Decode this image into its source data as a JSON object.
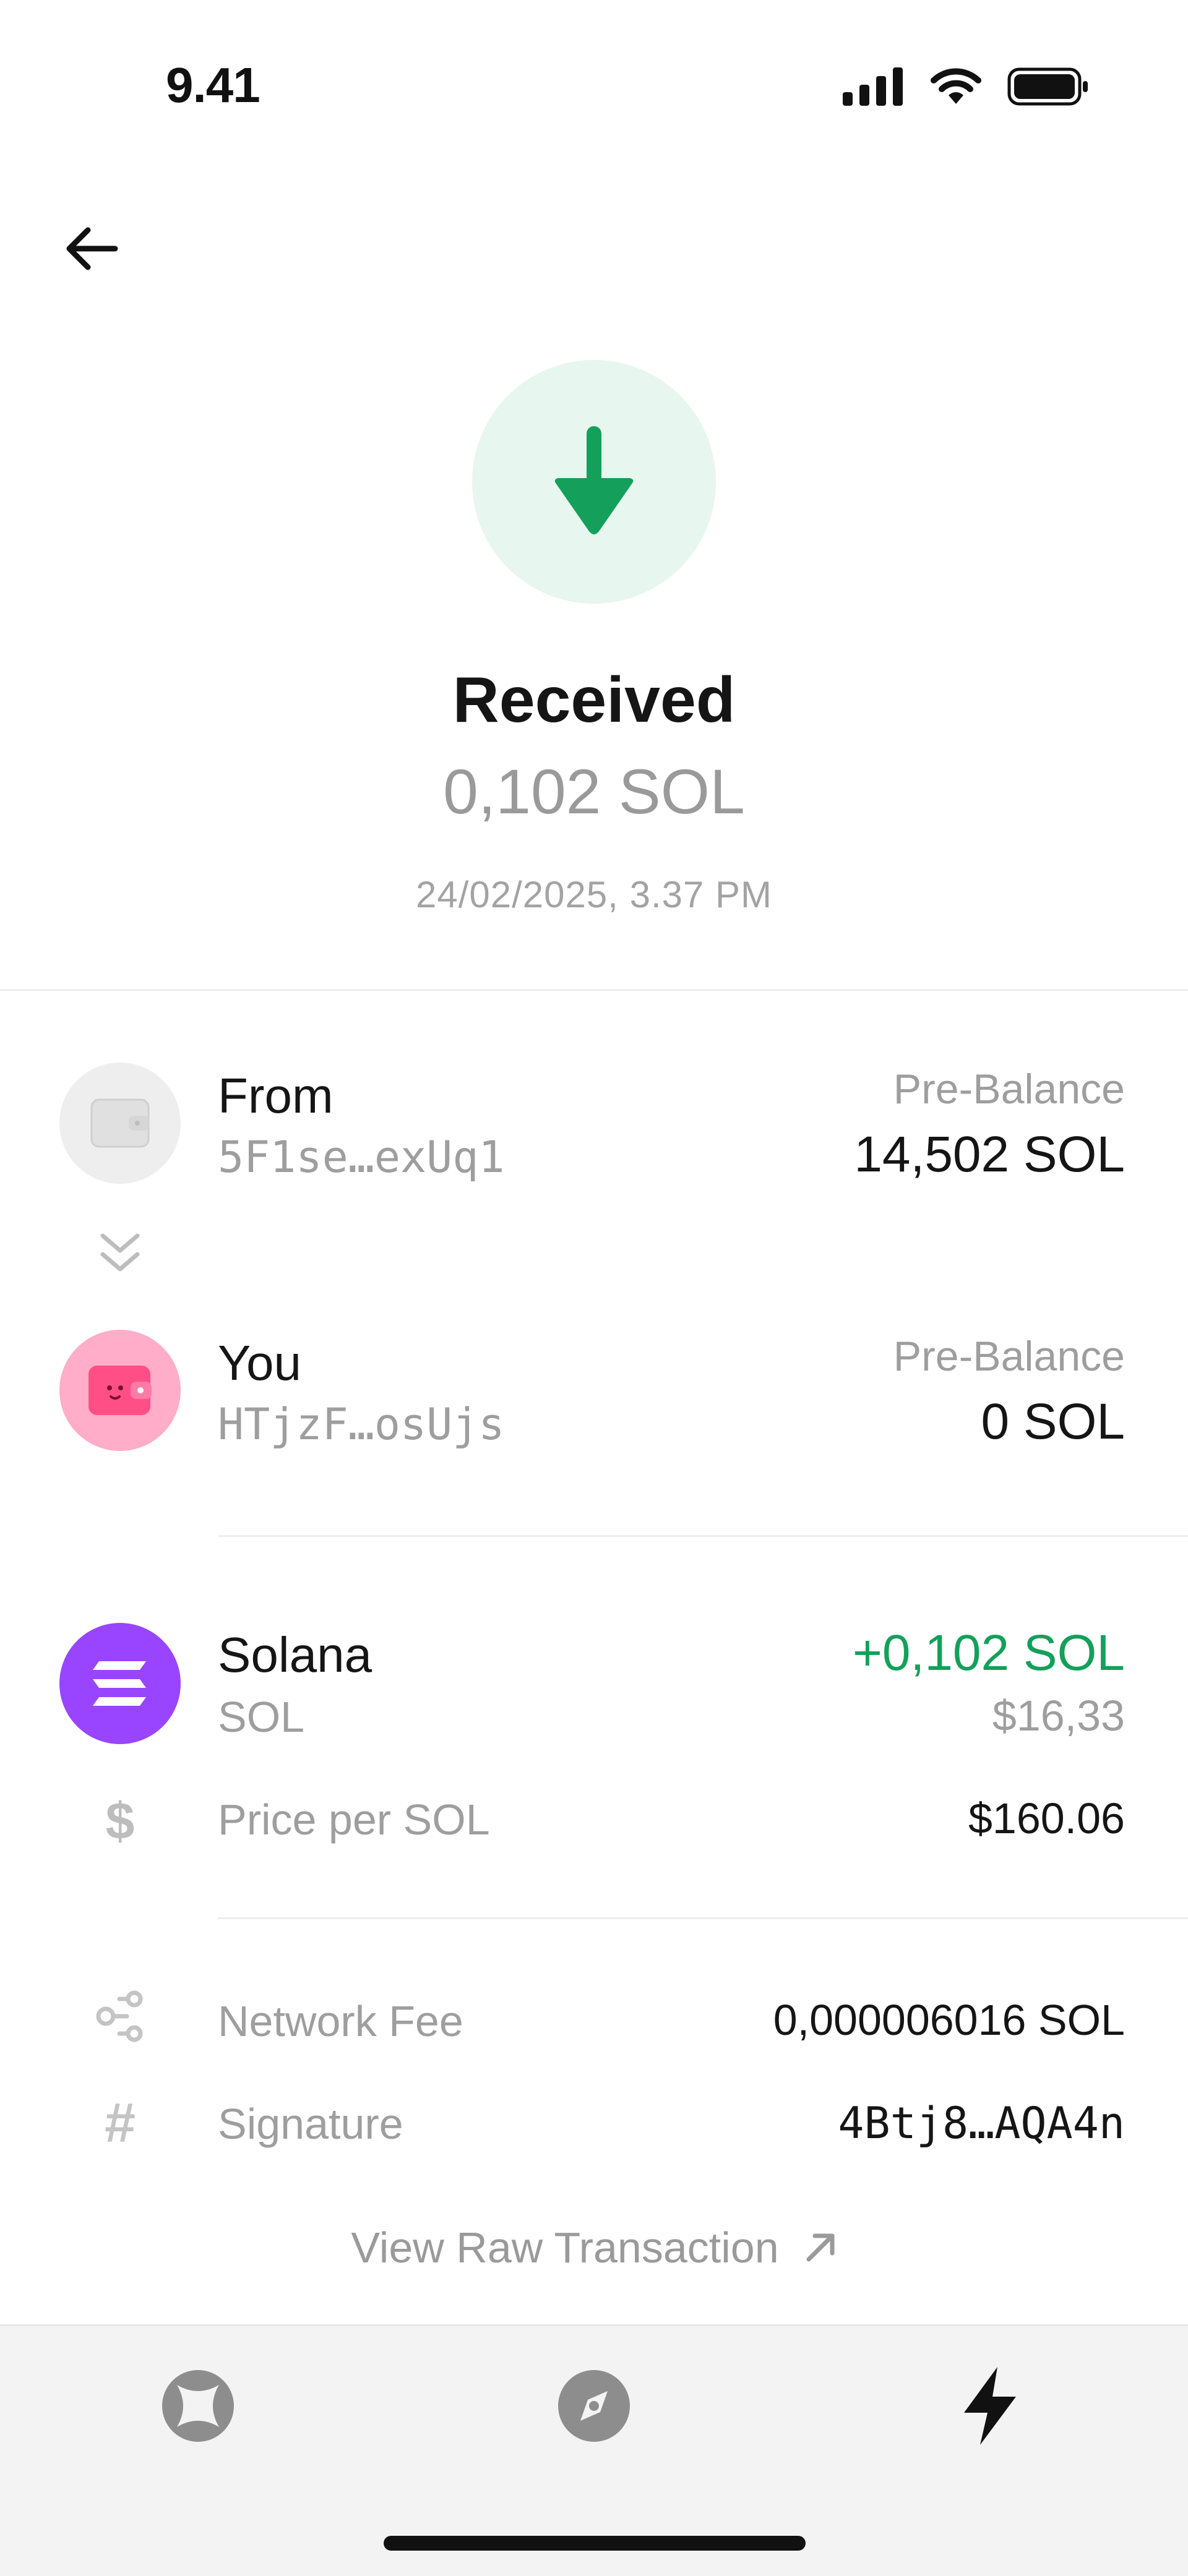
{
  "status_bar": {
    "time": "9.41"
  },
  "header": {
    "title": "Received",
    "amount": "0,102 SOL",
    "datetime": "24/02/2025, 3.37 PM"
  },
  "transfer": {
    "from": {
      "label": "From",
      "address": "5F1se…exUq1",
      "balance_label": "Pre-Balance",
      "balance": "14,502 SOL"
    },
    "to": {
      "label": "You",
      "address": "HTjzF…osUjs",
      "balance_label": "Pre-Balance",
      "balance": "0 SOL"
    }
  },
  "asset": {
    "name": "Solana",
    "ticker": "SOL",
    "change": "+0,102 SOL",
    "usd_value": "$16,33"
  },
  "price": {
    "label": "Price per SOL",
    "value": "$160.06"
  },
  "details": [
    {
      "label": "Network Fee",
      "value": "0,000006016 SOL"
    },
    {
      "label": "Signature",
      "value": "4Btj8…AQA4n"
    }
  ],
  "view_raw_label": "View Raw Transaction",
  "colors": {
    "accent_green": "#14a05a",
    "hero_bg": "#e7f6ee",
    "solana_purple": "#9945ff",
    "wallet_pink": "#ff6b9a"
  },
  "icons": {
    "back": "arrow-left-icon",
    "receive": "arrow-down-icon",
    "chevrons": "double-chevron-down-icon",
    "dollar": "dollar-icon",
    "fee": "network-icon",
    "signature": "hash-icon",
    "external": "arrow-up-right-icon",
    "tabs": [
      "explore-icon",
      "compass-icon",
      "lightning-icon"
    ]
  }
}
